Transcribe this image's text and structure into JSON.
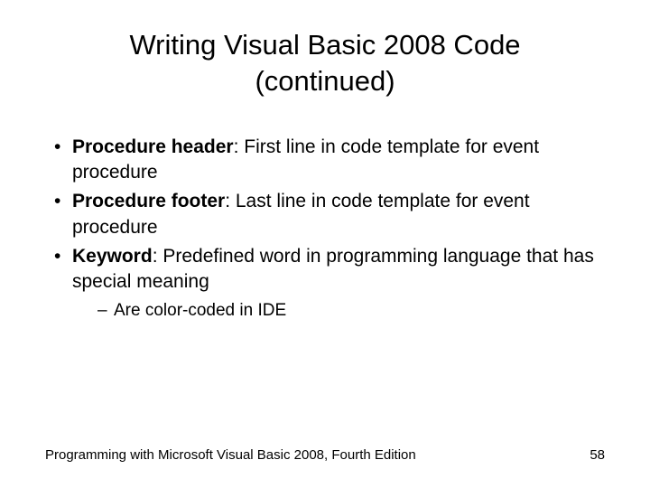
{
  "title": "Writing Visual Basic 2008 Code (continued)",
  "bullets": [
    {
      "term": "Procedure header",
      "definition": ": First line in code template for event procedure"
    },
    {
      "term": "Procedure footer",
      "definition": ": Last line in code template for event procedure"
    },
    {
      "term": "Keyword",
      "definition": ": Predefined word in programming language that has special meaning",
      "sub": [
        "Are color-coded in IDE"
      ]
    }
  ],
  "footer": {
    "left": "Programming with Microsoft Visual Basic 2008, Fourth Edition",
    "right": "58"
  }
}
